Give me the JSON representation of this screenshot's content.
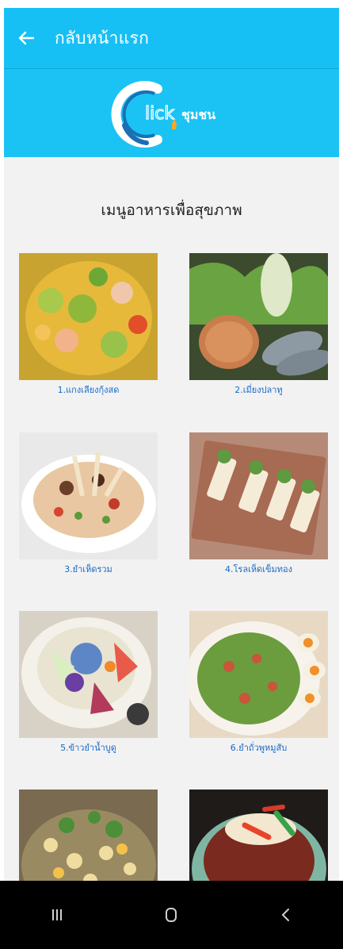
{
  "appbar": {
    "title": "กลับหน้าแรก"
  },
  "logo": {
    "text": "lick",
    "subtext": "ชุมชน",
    "colors": {
      "ring": "#ffffff",
      "accent": "#1b6fb3",
      "hand": "#f6a623"
    }
  },
  "section": {
    "title": "เมนูอาหารเพื่อสุขภาพ"
  },
  "menu_items": [
    {
      "label": "1.แกงเลียงกุ้งสด",
      "icon": "shrimp-soup-photo"
    },
    {
      "label": "2.เมี่ยงปลาทู",
      "icon": "mackerel-wrap-photo"
    },
    {
      "label": "3.ยำเห็ดรวม",
      "icon": "mushroom-salad-photo"
    },
    {
      "label": "4.โรลเห็ดเข็มทอง",
      "icon": "enoki-roll-photo"
    },
    {
      "label": "5.ข้าวยำน้ำบูดู",
      "icon": "rice-salad-photo"
    },
    {
      "label": "6.ยำถั่วพูหมูสับ",
      "icon": "wingbean-salad-photo"
    },
    {
      "label": "",
      "icon": "mixed-nut-salad-photo"
    },
    {
      "label": "",
      "icon": "spicy-dish-photo"
    }
  ],
  "colors": {
    "primary": "#17c0f4",
    "caption": "#1769c7",
    "background": "#f2f2f2"
  },
  "navbar": {
    "recent": "recent-apps-icon",
    "home": "home-icon",
    "back": "back-icon"
  }
}
